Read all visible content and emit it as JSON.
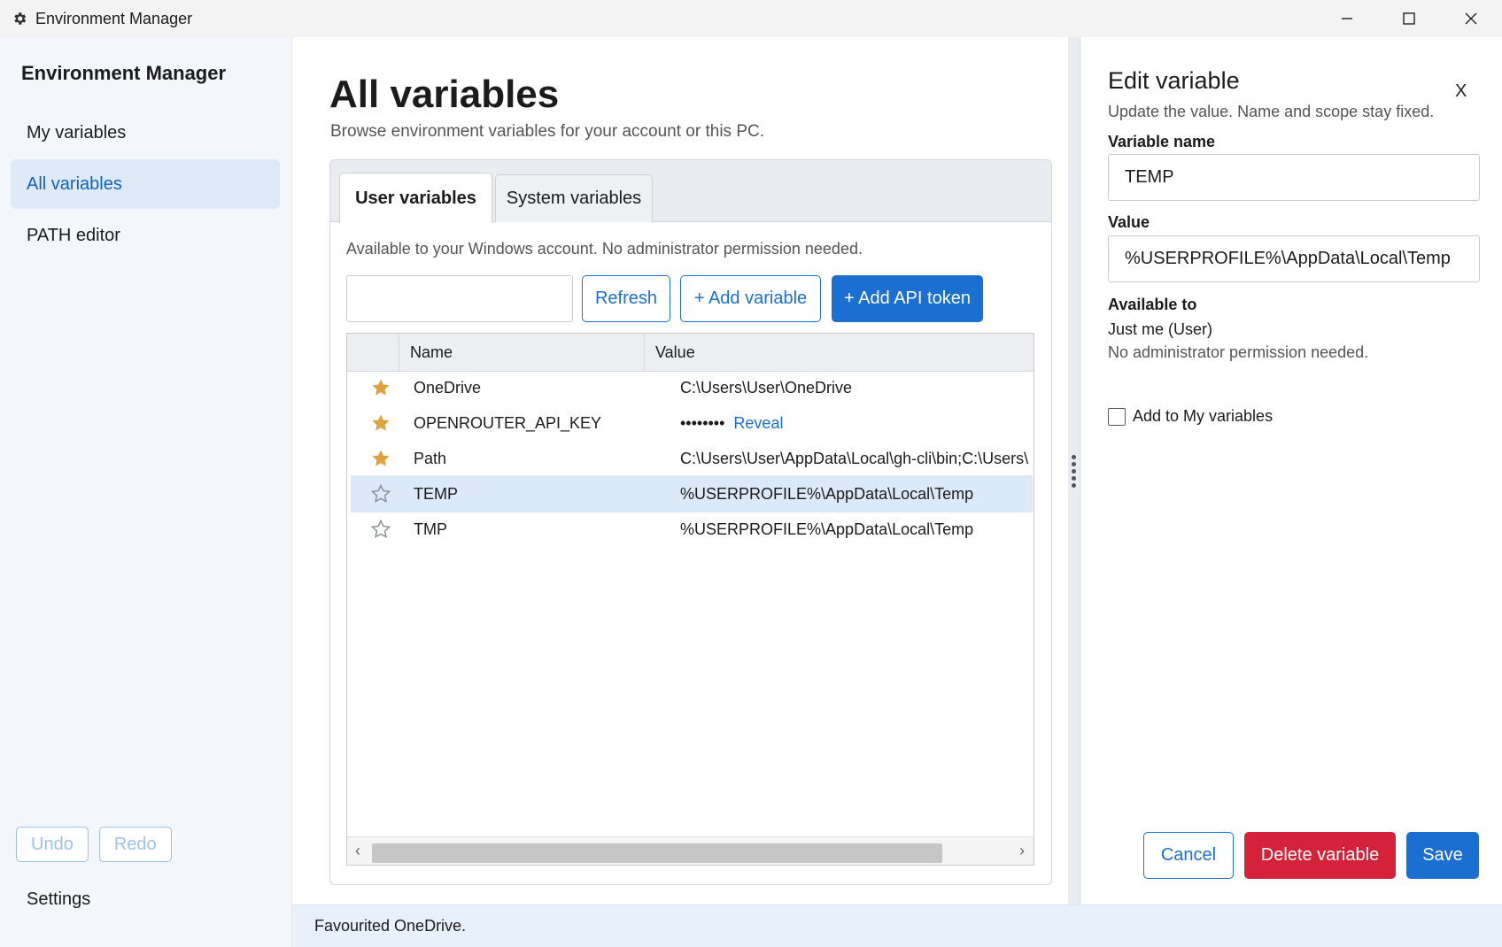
{
  "window": {
    "title": "Environment Manager",
    "controls": [
      "minimize",
      "maximize",
      "close"
    ]
  },
  "sidebar": {
    "title": "Environment Manager",
    "items": [
      {
        "label": "My variables",
        "active": false
      },
      {
        "label": "All variables",
        "active": true
      },
      {
        "label": "PATH editor",
        "active": false
      }
    ],
    "undo_label": "Undo",
    "redo_label": "Redo",
    "settings_label": "Settings"
  },
  "main": {
    "title": "All variables",
    "subtitle": "Browse environment variables for your account or this PC.",
    "tabs": [
      {
        "label": "User variables",
        "active": true
      },
      {
        "label": "System variables",
        "active": false
      }
    ],
    "scope_description": "Available to your Windows account. No administrator permission needed.",
    "search": {
      "value": "",
      "placeholder": ""
    },
    "buttons": {
      "refresh": "Refresh",
      "add_variable": "+ Add variable",
      "add_api_token": "+ Add API token"
    },
    "table": {
      "columns": [
        "Name",
        "Value"
      ],
      "rows": [
        {
          "favourite": true,
          "name": "OneDrive",
          "value": "C:\\Users\\User\\OneDrive",
          "masked": false,
          "selected": false
        },
        {
          "favourite": true,
          "name": "OPENROUTER_API_KEY",
          "value": "••••••••",
          "masked": true,
          "reveal_label": "Reveal",
          "selected": false
        },
        {
          "favourite": true,
          "name": "Path",
          "value": "C:\\Users\\User\\AppData\\Local\\gh-cli\\bin;C:\\Users\\",
          "masked": false,
          "selected": false
        },
        {
          "favourite": false,
          "name": "TEMP",
          "value": "%USERPROFILE%\\AppData\\Local\\Temp",
          "masked": false,
          "selected": true
        },
        {
          "favourite": false,
          "name": "TMP",
          "value": "%USERPROFILE%\\AppData\\Local\\Temp",
          "masked": false,
          "selected": false
        }
      ]
    }
  },
  "panel": {
    "title": "Edit variable",
    "close_label": "X",
    "subtitle": "Update the value. Name and scope stay fixed.",
    "name_label": "Variable name",
    "name_value": "TEMP",
    "value_label": "Value",
    "value_value": "%USERPROFILE%\\AppData\\Local\\Temp",
    "available_label": "Available to",
    "available_value": "Just me (User)",
    "permission_note": "No administrator permission needed.",
    "add_to_my_label": "Add to My variables",
    "add_to_my_checked": false,
    "cancel_label": "Cancel",
    "delete_label": "Delete variable",
    "save_label": "Save"
  },
  "status": {
    "message": "Favourited OneDrive."
  },
  "colors": {
    "accent": "#1a6fd0",
    "danger": "#d3223a",
    "star_filled": "#e0a23c",
    "star_empty": "#8a8f98",
    "selected_row": "#dce9f8"
  }
}
